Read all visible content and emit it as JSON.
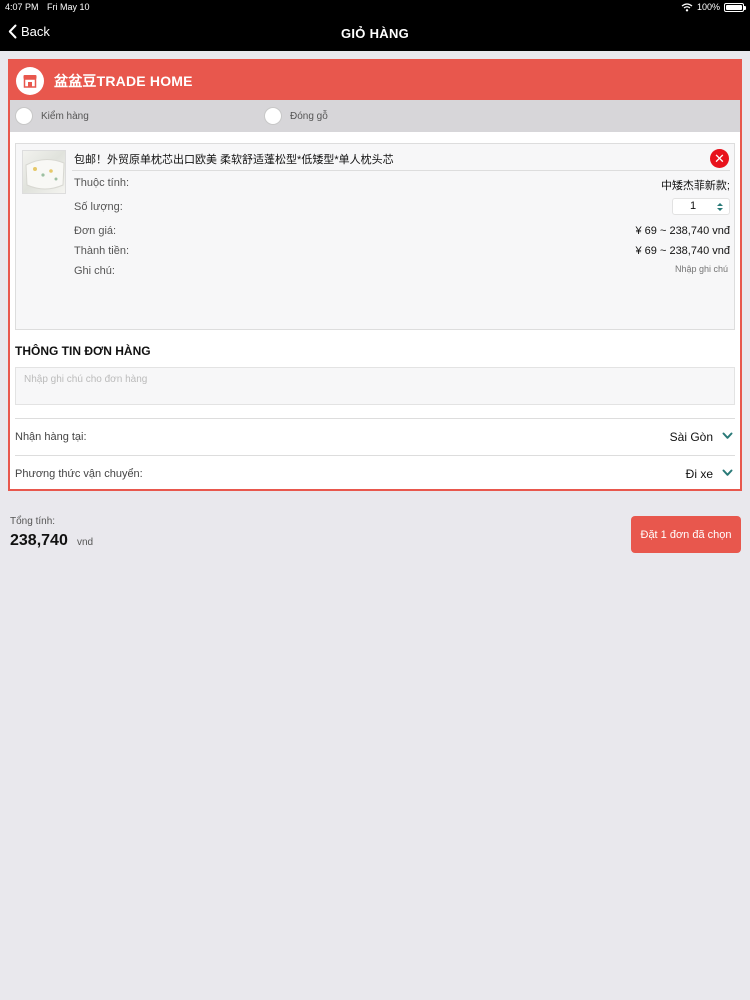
{
  "status_bar": {
    "time": "4:07 PM",
    "date": "Fri May 10",
    "battery": "100%"
  },
  "nav": {
    "back_label": "Back",
    "title": "GIỎ HÀNG"
  },
  "shop": {
    "name": "盆盆豆TRADE HOME",
    "options": [
      {
        "label": "Kiểm hàng"
      },
      {
        "label": "Đóng gỗ"
      }
    ]
  },
  "item": {
    "title": "包邮！外贸原单枕芯出口欧美 柔软舒适蓬松型*低矮型*单人枕头芯",
    "attribute_label": "Thuộc tính:",
    "attribute_value": "中矮杰菲新款;",
    "quantity_label": "Số lượng:",
    "quantity_value": "1",
    "unit_price_label": "Đơn giá:",
    "unit_price_value": "¥ 69 ~ 238,740 vnđ",
    "total_label": "Thành tiền:",
    "total_value": "¥ 69 ~ 238,740 vnđ",
    "note_label": "Ghi chú:",
    "note_placeholder": "Nhập ghi chú"
  },
  "order_info": {
    "title": "THÔNG TIN ĐƠN HÀNG",
    "note_placeholder": "Nhập ghi chú cho đơn hàng",
    "receive_label": "Nhận hàng tại:",
    "receive_value": "Sài Gòn",
    "shipping_label": "Phương thức vận chuyển:",
    "shipping_value": "Đi xe"
  },
  "footer": {
    "total_label": "Tổng tính:",
    "total_value": "238,740",
    "total_unit": "vnd",
    "order_button": "Đặt 1 đơn đã chọn"
  },
  "colors": {
    "accent": "#e8574d",
    "remove": "#e8121c",
    "chevron": "#2a7a78"
  }
}
